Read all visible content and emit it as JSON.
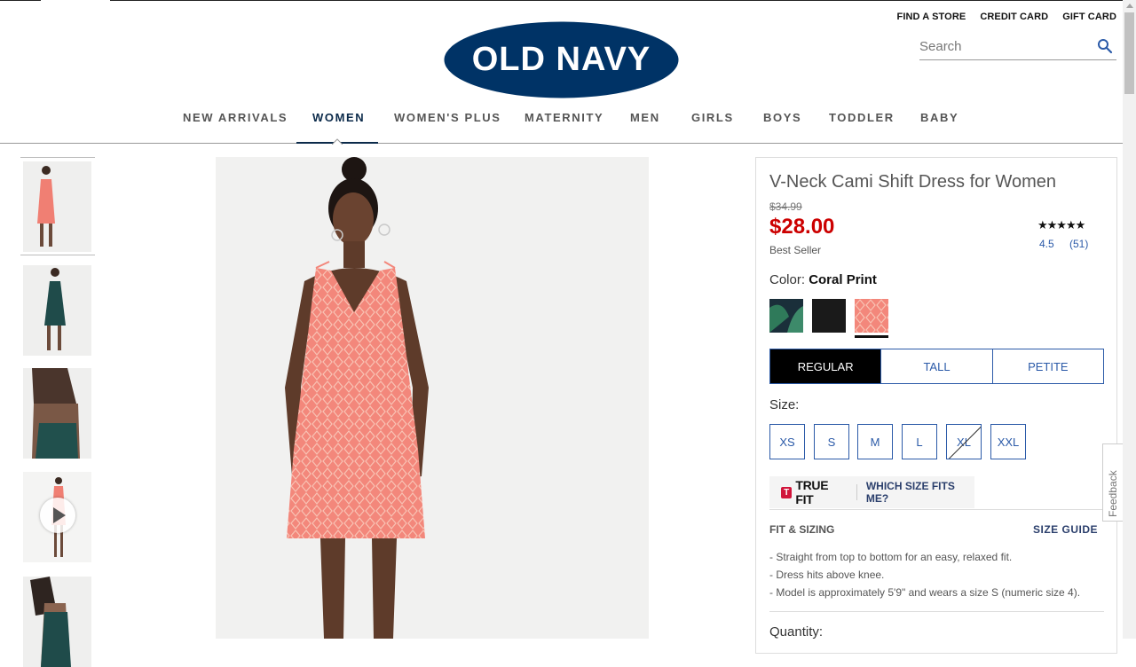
{
  "header": {
    "util_links": [
      "FIND A STORE",
      "CREDIT CARD",
      "GIFT CARD"
    ],
    "search_placeholder": "Search",
    "logo_text": "OLD NAVY",
    "logo_color": "#003366"
  },
  "nav": {
    "items": [
      "NEW ARRIVALS",
      "WOMEN",
      "WOMEN'S PLUS",
      "MATERNITY",
      "MEN",
      "GIRLS",
      "BOYS",
      "TODDLER",
      "BABY"
    ],
    "active": "WOMEN"
  },
  "product": {
    "title": "V-Neck Cami Shift Dress for Women",
    "original_price": "$34.99",
    "price": "$28.00",
    "badge": "Best Seller",
    "stars": "★★★★★",
    "rating": "4.5",
    "reviews": "(51)",
    "color_label": "Color:",
    "color_value": "Coral Print",
    "swatches": [
      {
        "name": "green palm print",
        "color": "#1e4a4a"
      },
      {
        "name": "black",
        "color": "#1a1a1a"
      },
      {
        "name": "coral print",
        "color": "#f08a7e",
        "selected": true
      }
    ],
    "fit_tabs": [
      "REGULAR",
      "TALL",
      "PETITE"
    ],
    "fit_selected": "REGULAR",
    "size_label": "Size:",
    "sizes": [
      "XS",
      "S",
      "M",
      "L",
      "XL",
      "XXL"
    ],
    "unavailable_size": "XL",
    "truefit_badge": "T",
    "truefit_text": "TRUE FIT",
    "truefit_link": "WHICH SIZE FITS ME?",
    "fit_heading": "FIT & SIZING",
    "size_guide": "SIZE GUIDE",
    "fit_bullets": [
      "- Straight from top to bottom for an easy, relaxed fit.",
      "- Dress hits above knee.",
      "- Model is approximately 5'9\" and wears a size S (numeric size 4)."
    ],
    "quantity_label": "Quantity:"
  },
  "feedback_label": "Feedback",
  "colors": {
    "accent_blue": "#2b5aa8",
    "sale_red": "#cc0000",
    "navy": "#0b2a4a"
  }
}
